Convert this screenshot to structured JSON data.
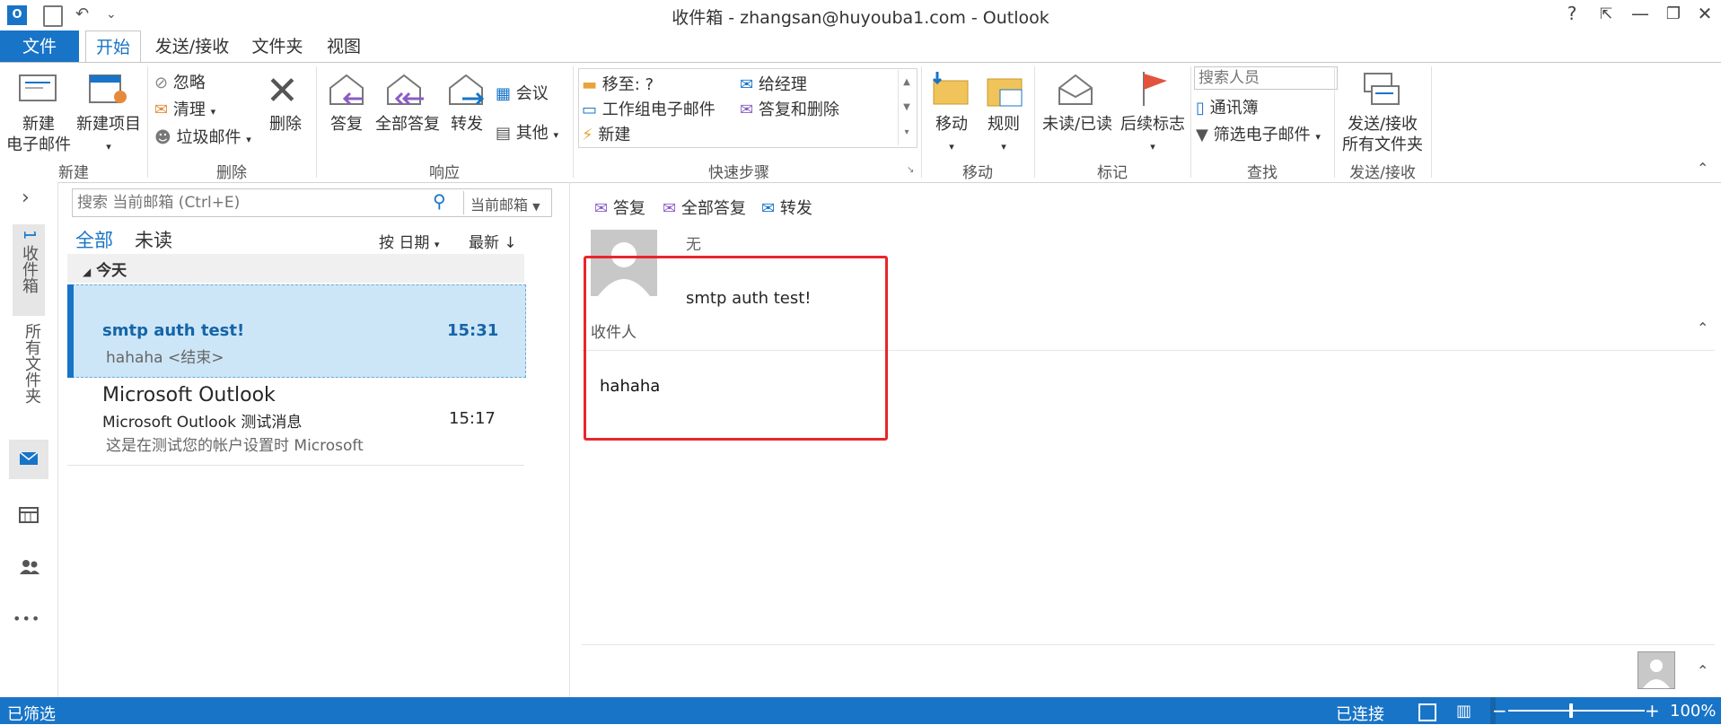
{
  "window": {
    "title": "收件箱 - zhangsan@huyouba1.com - Outlook",
    "help": "?",
    "restore_ribbon": "⇱",
    "minimize": "—",
    "maximize": "❐",
    "close": "✕"
  },
  "quick_access": {
    "undo": "↶",
    "customize": "⌄"
  },
  "tabs": {
    "file": "文件",
    "home": "开始",
    "send_receive": "发送/接收",
    "folder": "文件夹",
    "view": "视图"
  },
  "ribbon": {
    "new": {
      "new_email_line1": "新建",
      "new_email_line2": "电子邮件",
      "new_items": "新建项目",
      "group": "新建"
    },
    "delete": {
      "ignore": "忽略",
      "cleanup": "清理",
      "junk": "垃圾邮件",
      "delete": "删除",
      "group": "删除"
    },
    "respond": {
      "reply": "答复",
      "reply_all": "全部答复",
      "forward": "转发",
      "meeting": "会议",
      "more": "其他",
      "group": "响应"
    },
    "quicksteps": {
      "move_to": "移至: ?",
      "team_email": "工作组电子邮件",
      "new": "新建",
      "to_manager": "给经理",
      "reply_delete": "答复和删除",
      "group": "快速步骤"
    },
    "move": {
      "move": "移动",
      "rules": "规则",
      "group": "移动"
    },
    "tags": {
      "unread_read": "未读/已读",
      "followup": "后续标志",
      "group": "标记"
    },
    "find": {
      "search_people_placeholder": "搜索人员",
      "address_book": "通讯簿",
      "filter_email": "筛选电子邮件",
      "group": "查找"
    },
    "sendreceive": {
      "line1": "发送/接收",
      "line2": "所有文件夹",
      "group": "发送/接收"
    }
  },
  "nav": {
    "expand": "›",
    "inbox_label": "收件箱",
    "inbox_count": "1",
    "all_folders": "所有文件夹",
    "more": "•••"
  },
  "list": {
    "search_placeholder": "搜索 当前邮箱 (Ctrl+E)",
    "scope": "当前邮箱",
    "filter_all": "全部",
    "filter_unread": "未读",
    "sort_by": "按 日期",
    "order": "最新",
    "group_today": "今天",
    "messages": [
      {
        "subject": "smtp auth test!",
        "time": "15:31",
        "preview": "hahaha <结束>"
      },
      {
        "sender": "Microsoft Outlook",
        "subject": "Microsoft Outlook 测试消息",
        "time": "15:17",
        "preview": "这是在测试您的帐户设置时 Microsoft"
      }
    ]
  },
  "reading": {
    "reply": "答复",
    "reply_all": "全部答复",
    "forward": "转发",
    "from": "无",
    "subject": "smtp auth test!",
    "to_label": "收件人",
    "body": "hahaha"
  },
  "status": {
    "filter": "已筛选",
    "connected": "已连接",
    "zoom": "100%"
  },
  "colors": {
    "accent": "#1874c7",
    "selected_bg": "#cde6f7",
    "highlight_box": "#e8262b"
  }
}
